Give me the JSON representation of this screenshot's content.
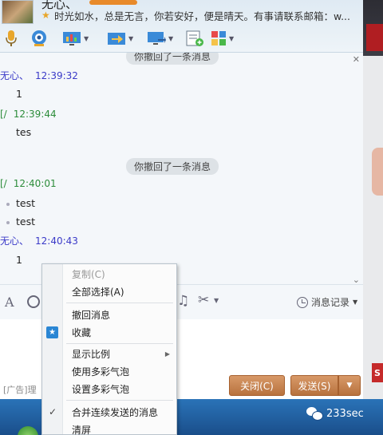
{
  "header": {
    "contact_name": "无心、",
    "signature": "时光如水，总是无言，你若安好，便是晴天。有事请联系邮箱：w..."
  },
  "toolbar": {
    "icons": [
      "microphone-icon",
      "video-call-icon",
      "screen-share-icon",
      "file-transfer-icon",
      "remote-desktop-icon",
      "add-contact-icon",
      "apps-icon"
    ]
  },
  "messages": {
    "recall_top": "你撤回了一条消息",
    "items": [
      {
        "sender": "无心、",
        "time": "12:39:32",
        "text": "1"
      },
      {
        "sender": "[/",
        "time": "12:39:44",
        "text": "tes"
      },
      {
        "sender": "[/",
        "time": "12:40:01",
        "lines": [
          "test",
          "test"
        ]
      },
      {
        "sender": "无心、",
        "time": "12:40:43",
        "text": "1"
      }
    ],
    "recall_middle": "你撤回了一条消息"
  },
  "input_toolbar": {
    "history_label": "消息记录"
  },
  "input_area": {
    "ad_text": "[广告]理",
    "close_label": "关闭(C)",
    "send_label": "发送(S)",
    "send_arrow": "▼"
  },
  "context_menu": {
    "items": [
      {
        "label": "复制(C)",
        "disabled": true
      },
      {
        "label": "全部选择(A)"
      },
      {
        "label": "撤回消息"
      },
      {
        "label": "收藏"
      },
      {
        "label": "显示比例"
      },
      {
        "label": "使用多彩气泡"
      },
      {
        "label": "设置多彩气泡"
      },
      {
        "label": "合并连续发送的消息",
        "checked": true
      },
      {
        "label": "清屏"
      }
    ]
  },
  "side": {
    "badge": "S"
  },
  "watermark": {
    "text": "233sec"
  },
  "colors": {
    "accent_button": "#c27d4a",
    "sender_blue": "#3a3ac8",
    "sender_green": "#2c8c3a",
    "taskbar": "#1f5e9c"
  }
}
